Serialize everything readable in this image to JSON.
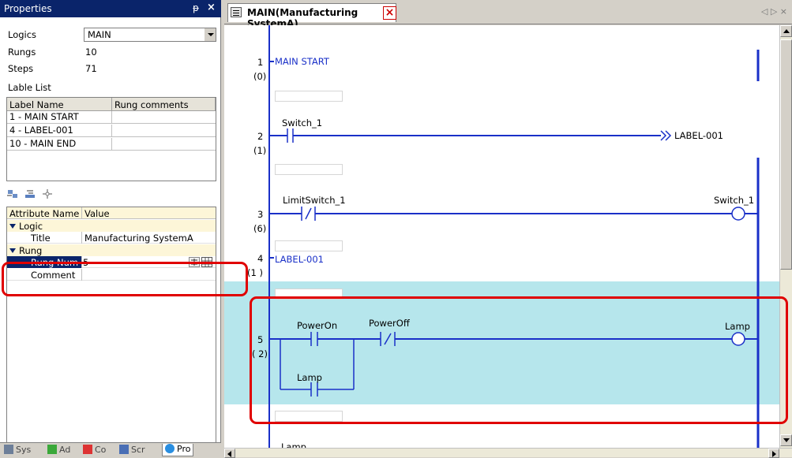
{
  "properties_panel": {
    "title": "Properties",
    "pin_icon": "pin-icon",
    "close_icon": "close-icon",
    "logics_label": "Logics",
    "logics_value": "MAIN",
    "rungs_label": "Rungs",
    "rungs_value": "10",
    "steps_label": "Steps",
    "steps_value": "71",
    "label_list_title": "Lable List",
    "label_table": {
      "headers": [
        "Label Name",
        "Rung comments"
      ],
      "rows": [
        "1 - MAIN START",
        "4 - LABEL-001",
        "10 - MAIN END"
      ]
    },
    "attributes": {
      "headers": [
        "Attribute Name",
        "Value"
      ],
      "logic_category": "Logic",
      "title_label": "Title",
      "title_value": "Manufacturing SystemA",
      "rung_category": "Rung",
      "rung_num_label": "Rung Num",
      "rung_num_value": "5",
      "comment_label": "Comment"
    }
  },
  "bottom_tabs": [
    {
      "label": "Sys",
      "icon": "system-icon"
    },
    {
      "label": "Ad",
      "icon": "address-icon"
    },
    {
      "label": "Co",
      "icon": "common-icon"
    },
    {
      "label": "Scr",
      "icon": "screen-icon"
    },
    {
      "label": "Pro",
      "icon": "properties-icon"
    }
  ],
  "editor": {
    "tab_title": "MAIN(Manufacturing SystemA)",
    "rungs": [
      {
        "num": "1",
        "step": "(0)",
        "label": "MAIN START"
      },
      {
        "num": "2",
        "step": "(1)",
        "contact": "Switch_1",
        "jump": "LABEL-001"
      },
      {
        "num": "3",
        "step": "(6)",
        "contact": "LimitSwitch_1",
        "coil": "Switch_1"
      },
      {
        "num": "4",
        "step": "(1 )",
        "label": "LABEL-001"
      },
      {
        "num": "5",
        "step": "( 2)",
        "contact_a": "PowerOn",
        "contact_b": "PowerOff",
        "contact_c": "Lamp",
        "coil": "Lamp"
      },
      {
        "partial_label": "Lamp"
      }
    ]
  },
  "colors": {
    "title_bar": "#0a246a",
    "rung_rail": "#1a30c8",
    "selected_rung": "#b6e6ec",
    "annotation": "#e00000"
  }
}
